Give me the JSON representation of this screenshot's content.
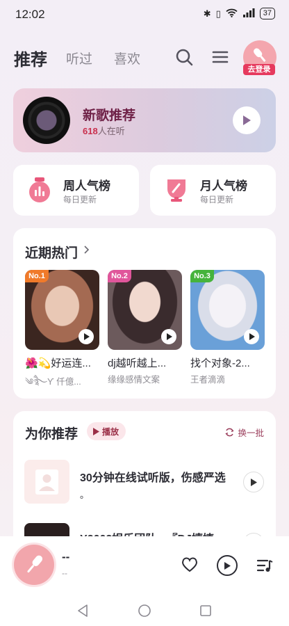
{
  "status": {
    "time": "12:02",
    "battery": "37",
    "signal": "4G"
  },
  "nav": {
    "tabs": [
      {
        "label": "推荐",
        "active": true
      },
      {
        "label": "听过",
        "active": false
      },
      {
        "label": "喜欢",
        "active": false
      }
    ],
    "login_badge": "去登录"
  },
  "banner": {
    "title": "新歌推荐",
    "listeners": "618",
    "listeners_suffix": "人在听"
  },
  "ranks": [
    {
      "title": "周人气榜",
      "sub": "每日更新",
      "icon": "bar-chart-bag-icon"
    },
    {
      "title": "月人气榜",
      "sub": "每日更新",
      "icon": "trophy-cup-icon"
    }
  ],
  "hot": {
    "title": "近期热门",
    "items": [
      {
        "rank": "No.1",
        "song": "🌺💫好运连...",
        "artist": "༄ཻ࿐Ƴ 仟億...",
        "tag_color": "#f07a2a"
      },
      {
        "rank": "No.2",
        "song": "dj越听越上...",
        "artist": "缘缘感情文案",
        "tag_color": "#e0569b"
      },
      {
        "rank": "No.3",
        "song": "找个对象-2...",
        "artist": "王者滴滴",
        "tag_color": "#46b33c"
      }
    ]
  },
  "recommend": {
    "title": "为你推荐",
    "play_label": "播放",
    "refresh_label": "换一批",
    "items": [
      {
        "title": "30分钟在线试听版，伤感严选",
        "title_line2": "。"
      },
      {
        "title": "Y2002娱乐团队 - 『DJ嬉婕",
        "title_line2": ""
      }
    ]
  },
  "player": {
    "title": "--",
    "subtitle": "--"
  }
}
